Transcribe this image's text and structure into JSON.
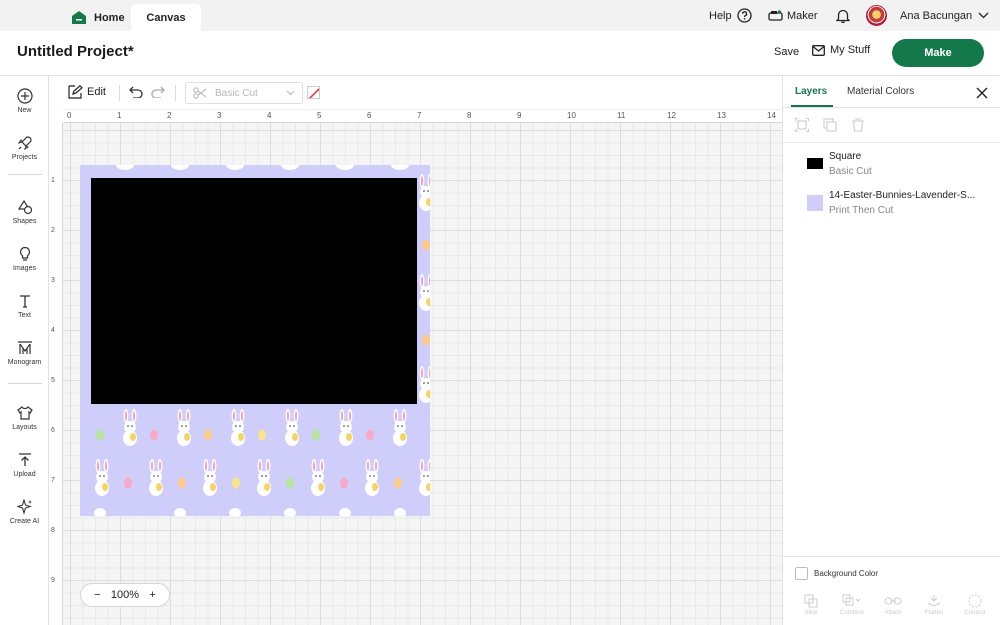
{
  "topnav": {
    "home_label": "Home",
    "canvas_label": "Canvas",
    "help_label": "Help",
    "maker_label": "Maker",
    "user_name": "Ana Bacungan"
  },
  "header": {
    "project_title": "Untitled Project*",
    "save_label": "Save",
    "mystuff_label": "My Stuff",
    "make_label": "Make"
  },
  "sidebar": {
    "items": [
      {
        "label": "New",
        "icon": "plus-circle-icon"
      },
      {
        "label": "Projects",
        "icon": "rocket-icon"
      },
      {
        "label": "Shapes",
        "icon": "shapes-icon"
      },
      {
        "label": "Images",
        "icon": "bulb-icon"
      },
      {
        "label": "Text",
        "icon": "text-icon"
      },
      {
        "label": "Monogram",
        "icon": "monogram-icon"
      },
      {
        "label": "Layouts",
        "icon": "shirt-icon"
      },
      {
        "label": "Upload",
        "icon": "upload-icon"
      },
      {
        "label": "Create AI",
        "icon": "sparkle-icon"
      }
    ]
  },
  "toolbar": {
    "edit_label": "Edit",
    "operation_value": "Basic Cut"
  },
  "ruler": {
    "top": [
      "0",
      "1",
      "2",
      "3",
      "4",
      "5",
      "6",
      "7",
      "8",
      "9",
      "10",
      "11",
      "12",
      "13",
      "14"
    ],
    "left": [
      "1",
      "2",
      "3",
      "4",
      "5",
      "6",
      "7",
      "8",
      "9"
    ]
  },
  "canvas": {
    "zoom_minus": "−",
    "zoom_value": "100%",
    "zoom_plus": "+"
  },
  "panel": {
    "tab_layers": "Layers",
    "tab_material": "Material Colors",
    "layers": [
      {
        "name": "Square",
        "type": "Basic Cut",
        "color": "#000000"
      },
      {
        "name": "14-Easter-Bunnies-Lavender-S...",
        "type": "Print Then Cut",
        "color": "#cfcdfa"
      }
    ],
    "background_color_label": "Background Color",
    "tools": [
      "Slice",
      "Combine",
      "Attach",
      "Flatten",
      "Contour"
    ]
  },
  "colors": {
    "accent": "#13794a",
    "pattern_bg": "#cfcdfa"
  }
}
